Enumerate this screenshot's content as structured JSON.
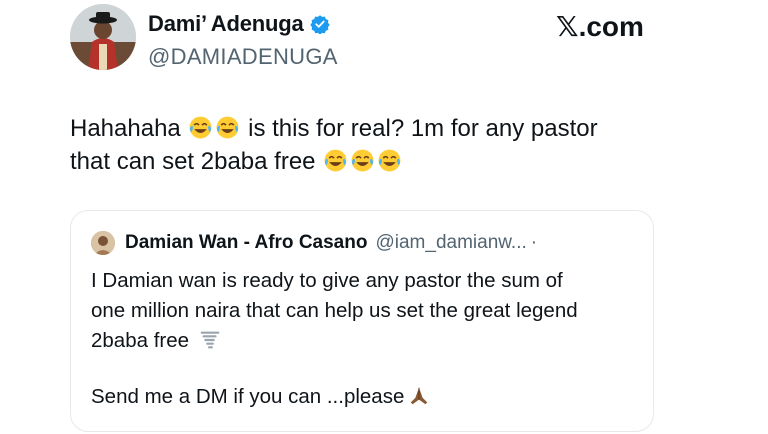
{
  "author": {
    "display_name": "Dami’ Adenuga",
    "handle": "@DAMIADENUGA",
    "verified": true
  },
  "brand": {
    "x_glyph": "𝕏",
    "suffix": ".com"
  },
  "tweet": {
    "line1_prefix": "Hahahaha",
    "line1_suffix": "is this for real? 1m for any pastor",
    "line2_text": "that can set 2baba free",
    "emoji": "face-with-tears-of-joy-icon"
  },
  "quote": {
    "display_name": "Damian Wan - Afro Casano",
    "handle": "@iam_damianw...",
    "dot": "·",
    "para1_line1": "I Damian wan is ready to give any pastor the sum of",
    "para1_line2": "one million naira that can help us set the great legend",
    "para1_line3": "2baba free",
    "para2": "Send me a DM if you can ...please",
    "icons": [
      "tornado-icon",
      "folded-hands-icon"
    ]
  },
  "colors": {
    "text": "#0f1419",
    "muted": "#536471",
    "verified_blue": "#1d9bf0",
    "border": "#e6e9ec"
  }
}
